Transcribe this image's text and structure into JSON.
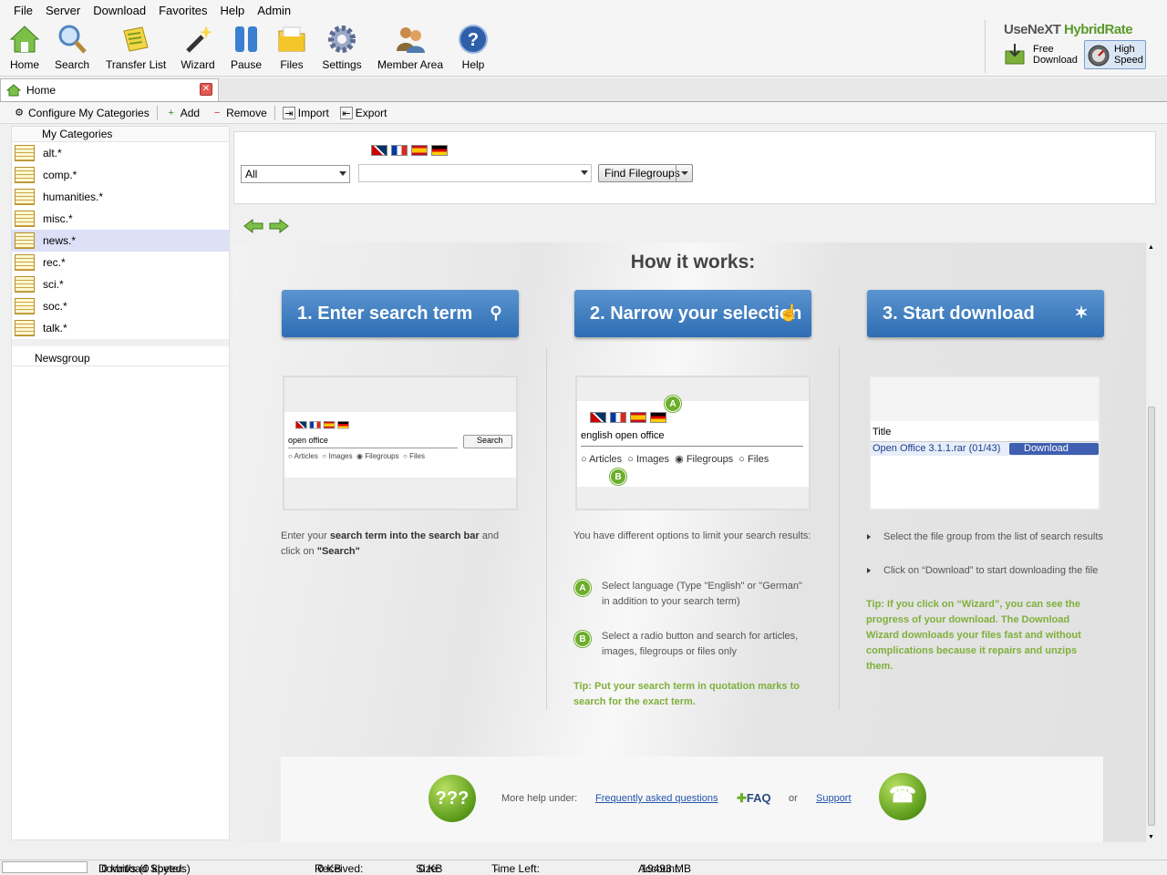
{
  "menu": [
    "File",
    "Server",
    "Download",
    "Favorites",
    "Help",
    "Admin"
  ],
  "toolbar": {
    "home": "Home",
    "search": "Search",
    "transfer_list": "Transfer List",
    "wizard": "Wizard",
    "pause": "Pause",
    "files": "Files",
    "settings": "Settings",
    "member_area": "Member Area",
    "help": "Help"
  },
  "brand": {
    "usenext": "UseNeXT",
    "hybridrate": "HybridRate",
    "free_download_1": "Free",
    "free_download_2": "Download",
    "high_speed_1": "High",
    "high_speed_2": "Speed"
  },
  "tab": {
    "label": "Home"
  },
  "subtoolbar": {
    "configure": "Configure My Categories",
    "add": "Add",
    "remove": "Remove",
    "import": "Import",
    "export": "Export"
  },
  "sidebar": {
    "header": "My Categories",
    "items": [
      "alt.*",
      "comp.*",
      "humanities.*",
      "misc.*",
      "news.*",
      "rec.*",
      "sci.*",
      "soc.*",
      "talk.*"
    ],
    "selected_index": 4,
    "newsgroup_header": "Newsgroup"
  },
  "search": {
    "scope_value": "All",
    "query_value": "",
    "find_button": "Find Filegroups"
  },
  "howto": {
    "title": "How it works:",
    "step1": "1. Enter search term",
    "step2": "2. Narrow your selection",
    "step3": "3. Start download",
    "shot1": {
      "query": "open office",
      "button": "Search",
      "radios": [
        "Articles",
        "Images",
        "Filegroups",
        "Files"
      ]
    },
    "shot2": {
      "query": "english open office",
      "radios": [
        "Articles",
        "Images",
        "Filegroups",
        "Files"
      ],
      "badge_a": "A",
      "badge_b": "B"
    },
    "shot3": {
      "column": "Title",
      "row": "Open Office 3.1.1.rar (01/43)",
      "button": "Download"
    },
    "col1": {
      "p1": "Enter your ",
      "p1b": "search term into the search bar",
      "p1c": " and click on ",
      "p1d": "\"Search\""
    },
    "col2": {
      "intro": "You have different options to limit your search results:",
      "a": "Select language (Type \"English\" or \"German\" in addition to your search term)",
      "b": "Select a radio button and search for articles, images, filegroups or files only",
      "tip": "Tip: Put your search term in quotation marks to search for the exact term."
    },
    "col3": {
      "b1": "Select the file group from the list of search results",
      "b2": "Click on “Download” to start downloading the file",
      "tip": "Tip: If you click on “Wizard”, you can see the progress of your download. The Download Wizard downloads your files fast and without complications because it repairs and unzips them."
    },
    "help": {
      "more": "More help under:",
      "faq_link": "Frequently asked questions",
      "faq": "FAQ",
      "or": "or",
      "support": "Support",
      "qmarks": "???"
    }
  },
  "status": {
    "speed_label": "Download Speed:",
    "speed_value": "0 kbit/s (0 kbyte/s)",
    "received_label": "Received:",
    "received_value": "0 KB",
    "size_label": "Size:",
    "size_value": "0 KB",
    "timeleft_label": "Time Left:",
    "timeleft_value": "-",
    "account_label": "Account:",
    "account_value": "19493 MB"
  },
  "colors": {
    "accent_blue": "#2e6db3",
    "tip_green": "#7fb03a",
    "selection": "#dde0f7"
  }
}
